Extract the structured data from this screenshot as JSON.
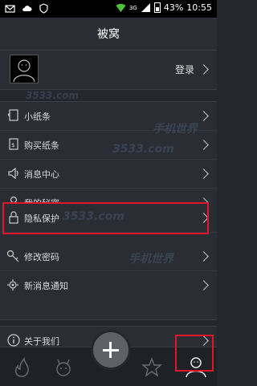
{
  "status_bar": {
    "signal_label": "3G",
    "battery_percent": "43%",
    "time": "10:55"
  },
  "header": {
    "title": "被窝"
  },
  "profile": {
    "login_label": "登录"
  },
  "menu_groups": [
    {
      "items": [
        {
          "label": "小纸条",
          "icon": "note-icon"
        },
        {
          "label": "购买纸条",
          "icon": "buy-note-icon"
        },
        {
          "label": "消息中心",
          "icon": "speaker-icon"
        },
        {
          "label": "我的秘密",
          "icon": "person-icon"
        }
      ]
    },
    {
      "items": [
        {
          "label": "隐私保护",
          "icon": "lock-icon"
        },
        {
          "label": "修改密码",
          "icon": "key-icon"
        },
        {
          "label": "新消息通知",
          "icon": "notification-gear-icon"
        }
      ]
    },
    {
      "items": [
        {
          "label": "关于我们",
          "icon": "info-icon"
        }
      ]
    }
  ],
  "bottom_nav": [
    {
      "name": "fire-icon"
    },
    {
      "name": "creature-icon"
    },
    {
      "name": "add-button"
    },
    {
      "name": "star-icon"
    },
    {
      "name": "profile-icon"
    }
  ],
  "watermarks": [
    "3533.com",
    "3533.com",
    "手机世界",
    "3533.com",
    "手机世界"
  ],
  "colors": {
    "highlight": "#e3152a",
    "background": "#24272d"
  }
}
